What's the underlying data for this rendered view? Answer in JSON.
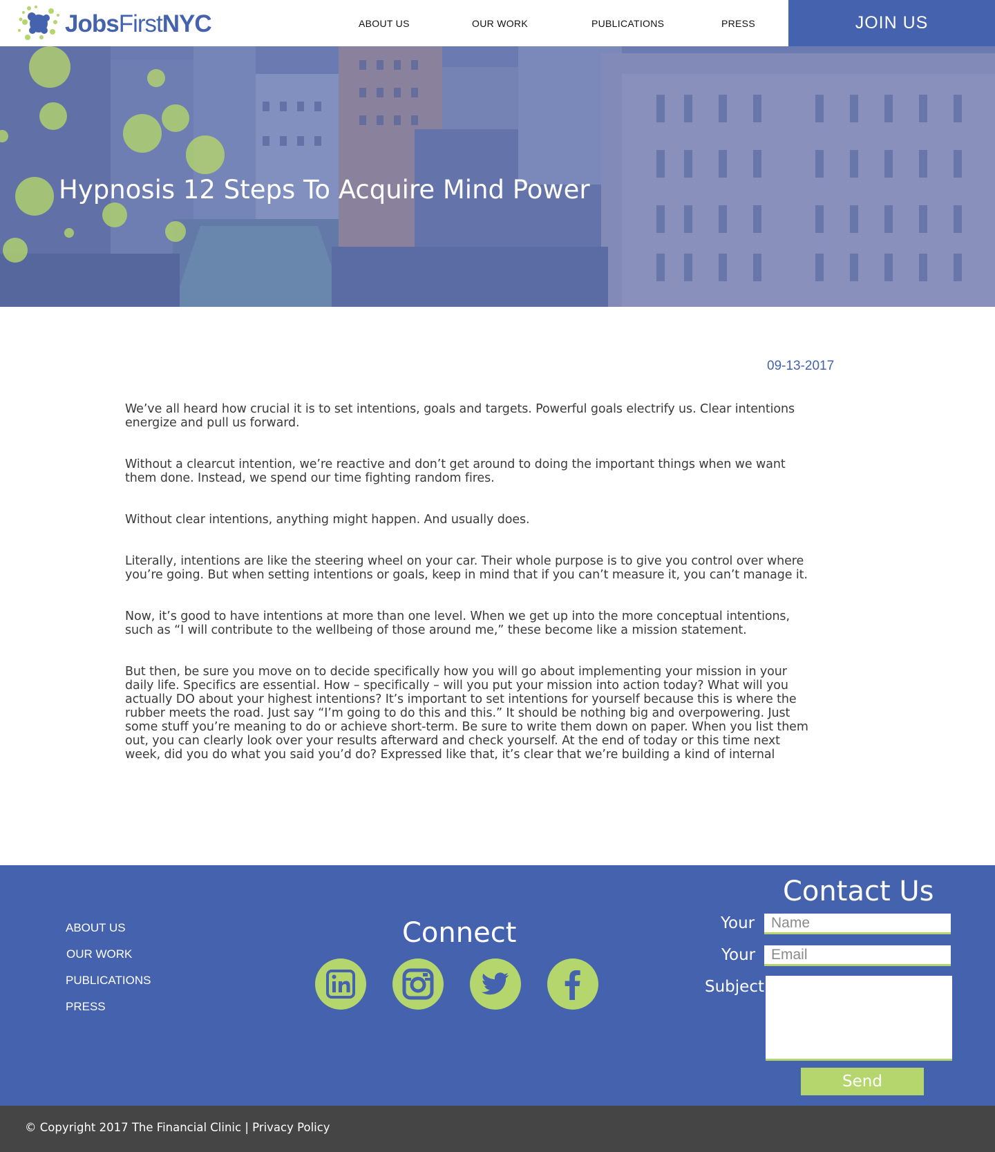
{
  "brand": {
    "logo_part1": "Jobs",
    "logo_part2": "First",
    "logo_part3": "NYC",
    "accent_color": "#4462ad",
    "green_color": "#b5d56d"
  },
  "nav": {
    "items": [
      {
        "label": "ABOUT US"
      },
      {
        "label": "OUR WORK"
      },
      {
        "label": "PUBLICATIONS"
      },
      {
        "label": "PRESS"
      }
    ],
    "join_label": "JOIN US"
  },
  "hero": {
    "title": "Hypnosis 12 Steps To Acquire Mind Power"
  },
  "article": {
    "date": "09-13-2017",
    "paragraphs": [
      "We’ve all heard how crucial it is to set intentions, goals and targets. Powerful goals electrify us. Clear intentions energize and pull us forward.",
      "Without a clearcut intention, we’re reactive and don’t get around to doing the important things when we want them done. Instead, we spend our time fighting random fires.",
      "Without clear intentions, anything might happen. And usually does.",
      "Literally, intentions are like the steering wheel on your car. Their whole purpose is to give you control over where you’re going. But when setting intentions or goals, keep in mind that if you can’t measure it, you can’t manage it.",
      "Now, it’s good to have intentions at more than one level. When we get up into the more conceptual intentions, such as “I will contribute to the wellbeing of those around me,” these become like a mission statement.",
      "But then, be sure you move on to decide specifically how you will go about implementing your mission in your daily life. Specifics are essential. How – specifically – will you put your mission into action today? What will you actually DO about your highest intentions? It’s important to set intentions for yourself because this is where the rubber meets the road. Just say “I’m going to do this and this.” It should be nothing big and overpowering. Just some stuff you’re meaning to do or achieve short-term. Be sure to write them down on paper. When you list them out, you can clearly look over your results afterward and check yourself. At the end of today or this time next week, did you do what you said you’d do? Expressed like that, it’s clear that we’re building a kind of internal integrity check within ourselves."
    ]
  },
  "footer": {
    "links": [
      {
        "label": "ABOUT US"
      },
      {
        "label": "OUR WORK"
      },
      {
        "label": "PUBLICATIONS"
      },
      {
        "label": "PRESS"
      }
    ],
    "connect_title": "Connect",
    "social": [
      {
        "icon": "linkedin-icon"
      },
      {
        "icon": "instagram-icon"
      },
      {
        "icon": "twitter-icon"
      },
      {
        "icon": "facebook-icon"
      }
    ],
    "contact": {
      "title": "Contact Us",
      "name_label": "Your",
      "name_placeholder": "Name",
      "email_label": "Your",
      "email_placeholder": "Email",
      "subject_label": "Subject",
      "send_label": "Send"
    }
  },
  "bottom": {
    "copyright": "© Copyright 2017 The Financial Clinic | Privacy Policy"
  }
}
